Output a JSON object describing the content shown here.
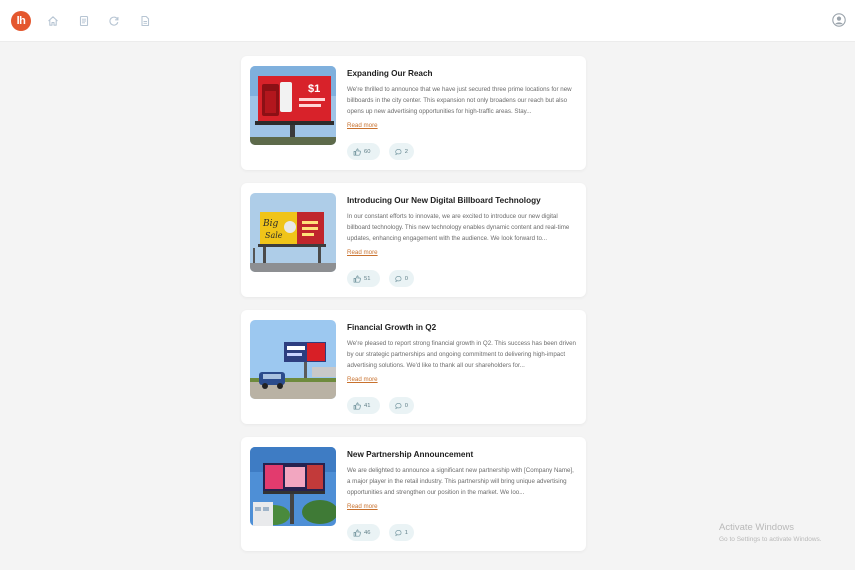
{
  "header": {
    "logo_text": "lh",
    "brand_color": "#e4572e",
    "nav_icons": [
      "home-icon",
      "document-icon",
      "refresh-icon",
      "file-icon"
    ],
    "profile_icon": "user-circle-icon"
  },
  "posts": [
    {
      "title": "Expanding Our Reach",
      "excerpt": "We're thrilled to announce that we have just secured three prime locations for new billboards in the city center. This expansion not only broadens our reach but also opens up new advertising opportunities for high-traffic areas. Stay...",
      "read_more": "Read more",
      "likes": "60",
      "comments": "2",
      "thumbnail_icon": "billboard-image"
    },
    {
      "title": "Introducing Our New Digital Billboard Technology",
      "excerpt": "In our constant efforts to innovate, we are excited to introduce our new digital billboard technology. This new technology enables dynamic content and real-time updates, enhancing engagement with the audience. We look forward to...",
      "read_more": "Read more",
      "likes": "51",
      "comments": "0",
      "thumbnail_icon": "billboard-image"
    },
    {
      "title": "Financial Growth in Q2",
      "excerpt": "We're pleased to report strong financial growth in Q2. This success has been driven by our strategic partnerships and ongoing commitment to delivering high-impact advertising solutions. We'd like to thank all our shareholders for...",
      "read_more": "Read more",
      "likes": "41",
      "comments": "0",
      "thumbnail_icon": "billboard-image"
    },
    {
      "title": "New Partnership Announcement",
      "excerpt": "We are delighted to announce a significant new partnership with [Company Name], a major player in the retail industry. This partnership will bring unique advertising opportunities and strengthen our position in the market. We loo...",
      "read_more": "Read more",
      "likes": "46",
      "comments": "1",
      "thumbnail_icon": "billboard-image"
    }
  ],
  "watermark": {
    "line1": "Activate Windows",
    "line2": "Go to Settings to activate Windows."
  },
  "colors": {
    "background": "#f4f4f4",
    "card": "#ffffff",
    "read_more": "#c8712d",
    "chip_bg": "#eaf3f5"
  }
}
